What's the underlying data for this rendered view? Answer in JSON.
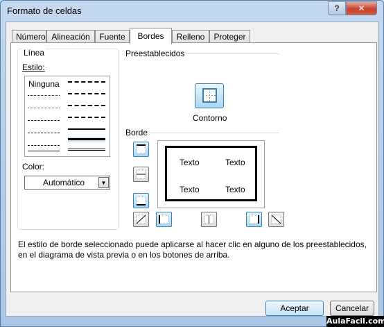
{
  "window": {
    "title": "Formato de celdas"
  },
  "titlebar": {
    "help_icon": "?",
    "close_icon": "✕"
  },
  "tabs": [
    {
      "label": "Número"
    },
    {
      "label": "Alineación"
    },
    {
      "label": "Fuente"
    },
    {
      "label": "Bordes",
      "active": true
    },
    {
      "label": "Relleno"
    },
    {
      "label": "Proteger"
    }
  ],
  "linea": {
    "group_label": "Línea",
    "estilo_label": "Estilo:",
    "none_label": "Ninguna",
    "color_label": "Color:",
    "color_value": "Automático"
  },
  "preestablecidos": {
    "label": "Preestablecidos",
    "contorno_label": "Contorno"
  },
  "borde": {
    "label": "Borde"
  },
  "preview": {
    "cells": [
      "Texto",
      "Texto",
      "Texto",
      "Texto"
    ]
  },
  "footer": {
    "text": "El estilo de borde seleccionado puede aplicarse al hacer clic en alguno de los preestablecidos, en el diagrama de vista previa o en los botones de arriba."
  },
  "buttons": {
    "accept": "Aceptar",
    "cancel": "Cancelar"
  },
  "watermark": "AulaFacil.com",
  "colors": {
    "accent_blue": "#3c7fb1",
    "button_on": "#a9d9f3",
    "close_red": "#c7432a"
  }
}
